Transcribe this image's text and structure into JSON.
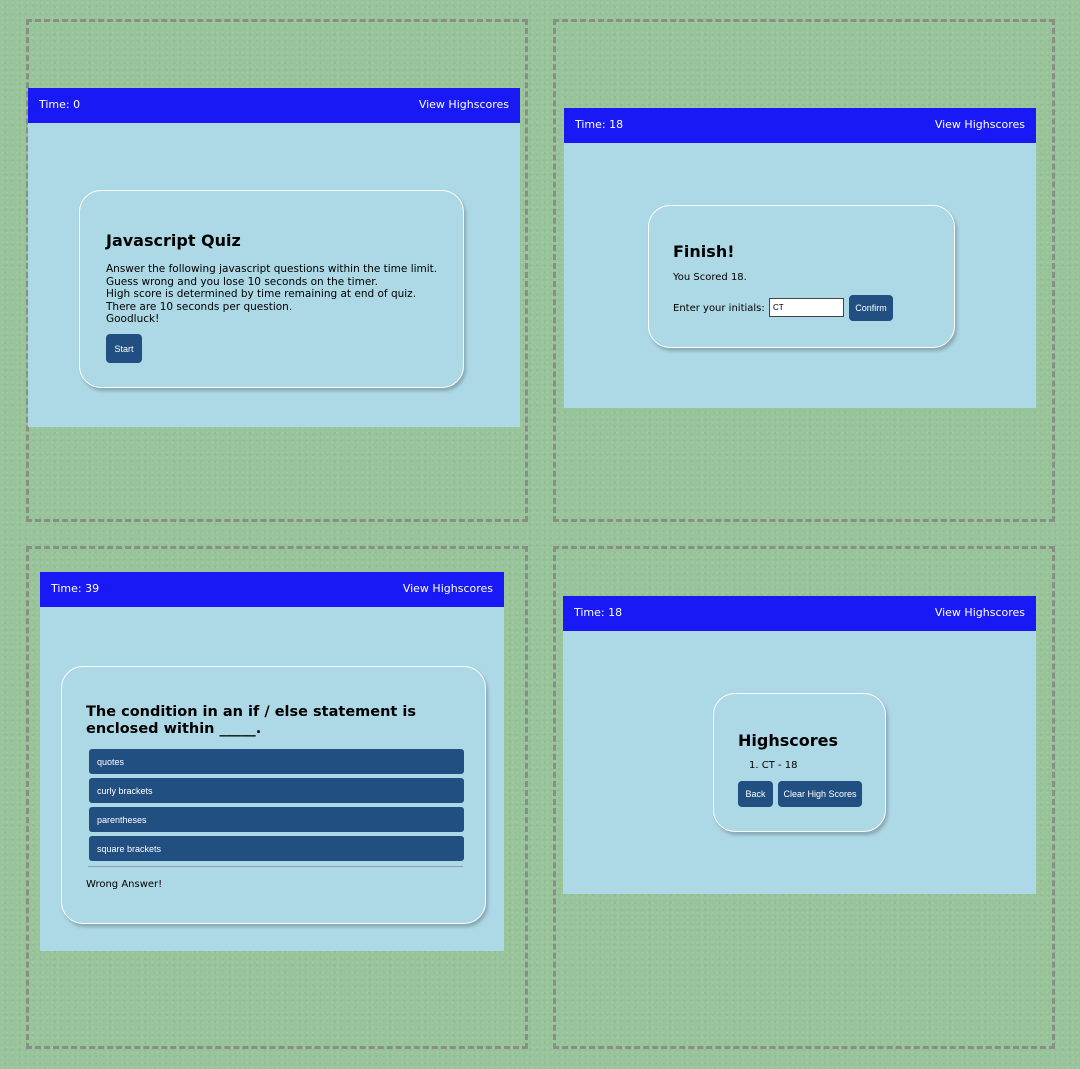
{
  "panels": {
    "start": {
      "header": {
        "time": "Time: 0",
        "view_highscores": "View Highscores"
      },
      "title": "Javascript Quiz",
      "instructions": [
        "Answer the following javascript questions within the time limit.",
        "Guess wrong and you lose 10 seconds on the timer.",
        "High score is determined by time remaining at end of quiz.",
        "There are 10 seconds per question.",
        "Goodluck!"
      ],
      "start_label": "Start"
    },
    "finish": {
      "header": {
        "time": "Time: 18",
        "view_highscores": "View Highscores"
      },
      "title": "Finish!",
      "score_text": "You Scored 18.",
      "initials_label": "Enter your initials:",
      "initials_value": "CT",
      "confirm_label": "Confirm"
    },
    "question": {
      "header": {
        "time": "Time: 39",
        "view_highscores": "View Highscores"
      },
      "question_line1": "The condition in an if / else statement is",
      "question_line2": "enclosed within _____.",
      "answers": [
        "quotes",
        "curly brackets",
        "parentheses",
        "square brackets"
      ],
      "feedback": "Wrong Answer!"
    },
    "highscores": {
      "header": {
        "time": "Time: 18",
        "view_highscores": "View Highscores"
      },
      "title": "Highscores",
      "entries": [
        "1. CT - 18"
      ],
      "back_label": "Back",
      "clear_label": "Clear High Scores"
    }
  },
  "colors": {
    "background": "#98c49a",
    "header": "#1919f5",
    "screen": "#add8e6",
    "button": "#214f82",
    "border_dash": "#8a8f86"
  }
}
